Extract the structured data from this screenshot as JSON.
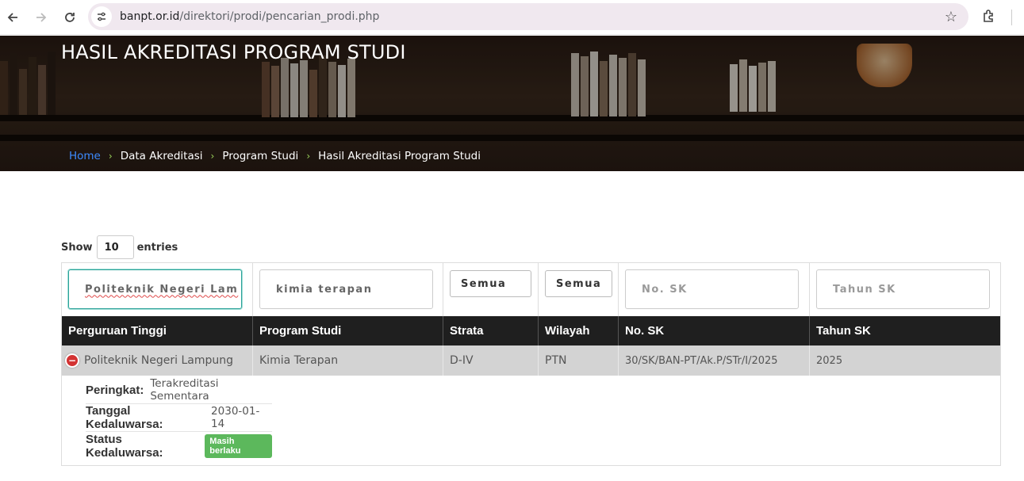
{
  "browser": {
    "url_host": "banpt.or.id",
    "url_path": "/direktori/prodi/pencarian_prodi.php"
  },
  "hero": {
    "title": "HASIL AKREDITASI PROGRAM STUDI",
    "breadcrumb": [
      "Home",
      "Data Akreditasi",
      "Program Studi",
      "Hasil Akreditasi Program Studi"
    ]
  },
  "length": {
    "show_label": "Show",
    "value": "10",
    "entries_label": "entries"
  },
  "filters": {
    "perguruan_tinggi": "Politeknik Negeri Lam",
    "program_studi": "kimia terapan",
    "strata": "Semua",
    "wilayah": "Semua",
    "no_sk_placeholder": "No. SK",
    "tahun_sk_placeholder": "Tahun SK"
  },
  "columns": [
    "Perguruan Tinggi",
    "Program Studi",
    "Strata",
    "Wilayah",
    "No. SK",
    "Tahun SK"
  ],
  "rows": [
    {
      "perguruan_tinggi": "Politeknik Negeri Lampung",
      "program_studi": "Kimia Terapan",
      "strata": "D-IV",
      "wilayah": "PTN",
      "no_sk": "30/SK/BAN-PT/Ak.P/STr/I/2025",
      "tahun_sk": "2025"
    }
  ],
  "details": {
    "peringkat_label": "Peringkat:",
    "peringkat": "Terakreditasi Sementara",
    "tanggal_label": "Tanggal Kedaluwarsa:",
    "tanggal": "2030-01-14",
    "status_label": "Status Kedaluwarsa:",
    "status": "Masih berlaku",
    "status_color": "#5cb85c"
  }
}
